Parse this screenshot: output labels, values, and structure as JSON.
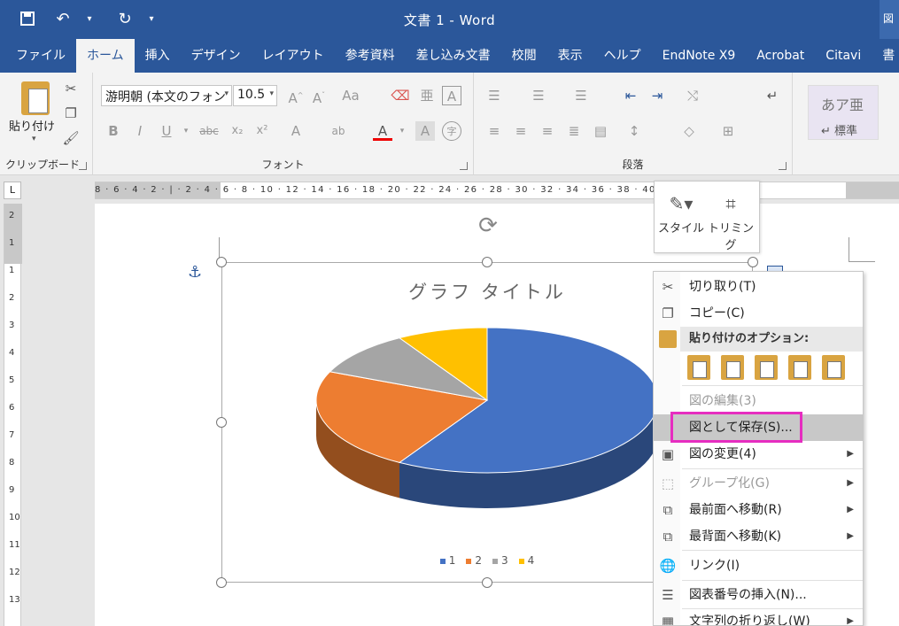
{
  "titlebar": {
    "title": "文書 1  -  Word",
    "right_text": "図"
  },
  "qat": {
    "save_icon": "save-icon",
    "undo_icon": "undo-icon",
    "redo_icon": "redo-icon",
    "customize_icon": "customize-icon"
  },
  "tabs": [
    "ファイル",
    "ホーム",
    "挿入",
    "デザイン",
    "レイアウト",
    "参考資料",
    "差し込み文書",
    "校閲",
    "表示",
    "ヘルプ",
    "EndNote X9",
    "Acrobat",
    "Citavi",
    "書"
  ],
  "active_tab": "ホーム",
  "ribbon": {
    "clipboard": {
      "paste_label": "貼り付け",
      "group_label": "クリップボード"
    },
    "font": {
      "font_name": "游明朝 (本文のフォン",
      "font_size": "10.5",
      "group_label": "フォント"
    },
    "paragraph": {
      "group_label": "段落"
    },
    "styles": {
      "sample": "あア亜",
      "name": "↵ 標準"
    }
  },
  "ruler": {
    "corner": "L",
    "h_ticks": "8 · 6 · 4 · 2 · | · 2 · 4 · 6 · 8 · 10 · 12 · 14 · 16 · 18 · 20 · 22 · 24 · 26 · 28 · 30 · 32 · 34 · 36 · 38 · 40 · 42",
    "v_numbers": [
      "2",
      "1",
      "1",
      "2",
      "3",
      "4",
      "5",
      "6",
      "7",
      "8",
      "9",
      "10",
      "11",
      "12",
      "13"
    ]
  },
  "chart": {
    "title": "グラフ タイトル",
    "legend": [
      "1",
      "2",
      "3",
      "4"
    ]
  },
  "chart_data": {
    "type": "pie",
    "title": "グラフ タイトル",
    "categories": [
      "1",
      "2",
      "3",
      "4"
    ],
    "values": [
      8.2,
      3.2,
      1.4,
      1.2
    ],
    "colors": [
      "#4472c4",
      "#ed7d31",
      "#a5a5a5",
      "#ffc000"
    ],
    "legend_position": "bottom"
  },
  "minitoolbar": {
    "style_label": "スタイル",
    "crop_label": "トリミング"
  },
  "context_menu": {
    "cut": "切り取り(T)",
    "copy": "コピー(C)",
    "paste_header": "貼り付けのオプション:",
    "edit_picture": "図の編集(3)",
    "save_as_picture": "図として保存(S)...",
    "change_picture": "図の変更(4)",
    "group": "グループ化(G)",
    "bring_front": "最前面へ移動(R)",
    "send_back": "最背面へ移動(K)",
    "link": "リンク(I)",
    "insert_caption": "図表番号の挿入(N)...",
    "wrap_text": "文字列の折り返し(W)"
  },
  "colors": {
    "word_blue": "#2b579a",
    "highlight": "#e62dc0"
  }
}
